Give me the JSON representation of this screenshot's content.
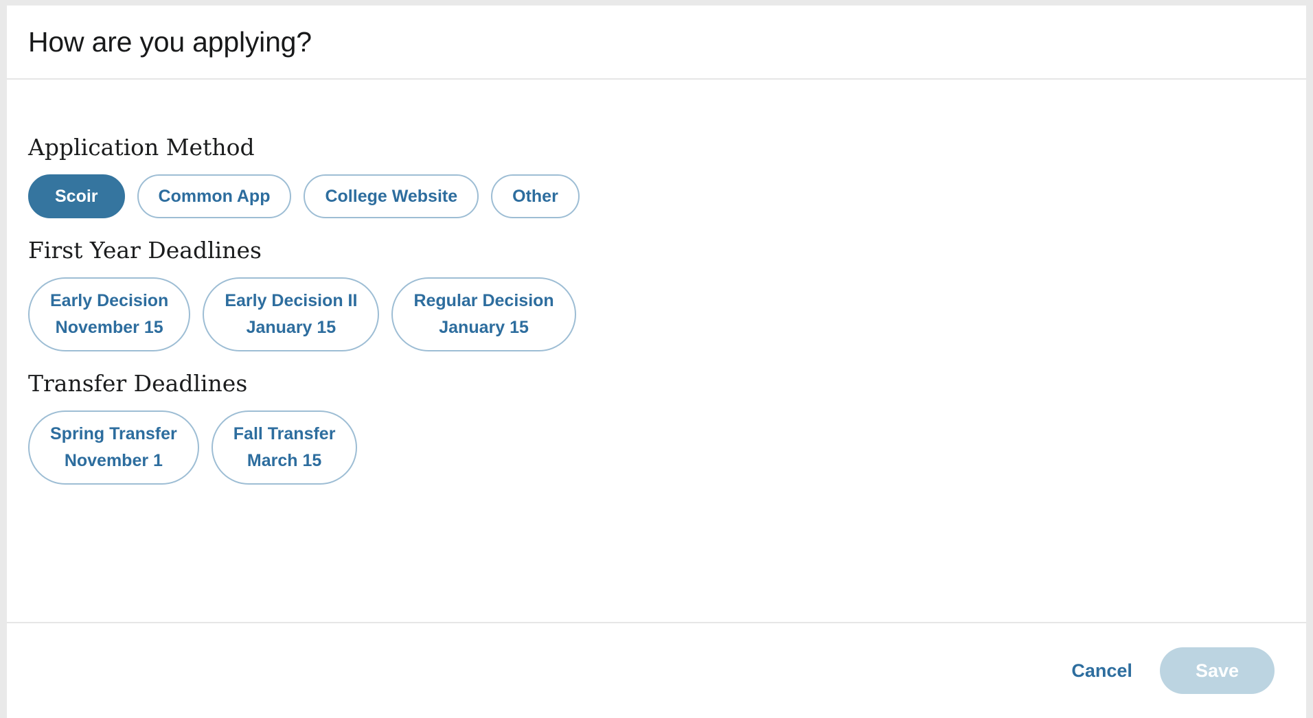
{
  "modal": {
    "title": "How are you applying?",
    "sections": [
      {
        "key": "application_method",
        "heading": "Application Method",
        "options": [
          {
            "label": "Scoir",
            "selected": true
          },
          {
            "label": "Common App",
            "selected": false
          },
          {
            "label": "College Website",
            "selected": false
          },
          {
            "label": "Other",
            "selected": false
          }
        ]
      },
      {
        "key": "first_year_deadlines",
        "heading": "First Year Deadlines",
        "options": [
          {
            "name": "Early Decision",
            "date": "November 15",
            "selected": false
          },
          {
            "name": "Early Decision II",
            "date": "January 15",
            "selected": false
          },
          {
            "name": "Regular Decision",
            "date": "January 15",
            "selected": false
          }
        ]
      },
      {
        "key": "transfer_deadlines",
        "heading": "Transfer Deadlines",
        "options": [
          {
            "name": "Spring Transfer",
            "date": "November 1",
            "selected": false
          },
          {
            "name": "Fall Transfer",
            "date": "March 15",
            "selected": false
          }
        ]
      }
    ],
    "footer": {
      "cancel_label": "Cancel",
      "save_label": "Save",
      "save_disabled": true
    }
  },
  "colors": {
    "accent_blue": "#35759f",
    "text_blue": "#2d6d9e",
    "pill_border": "#9dbdd4",
    "save_disabled_bg": "#bcd4e1",
    "divider": "#e6e6e6",
    "page_bg": "#e9e9e9",
    "surface": "#ffffff",
    "title_text": "#18191a"
  }
}
